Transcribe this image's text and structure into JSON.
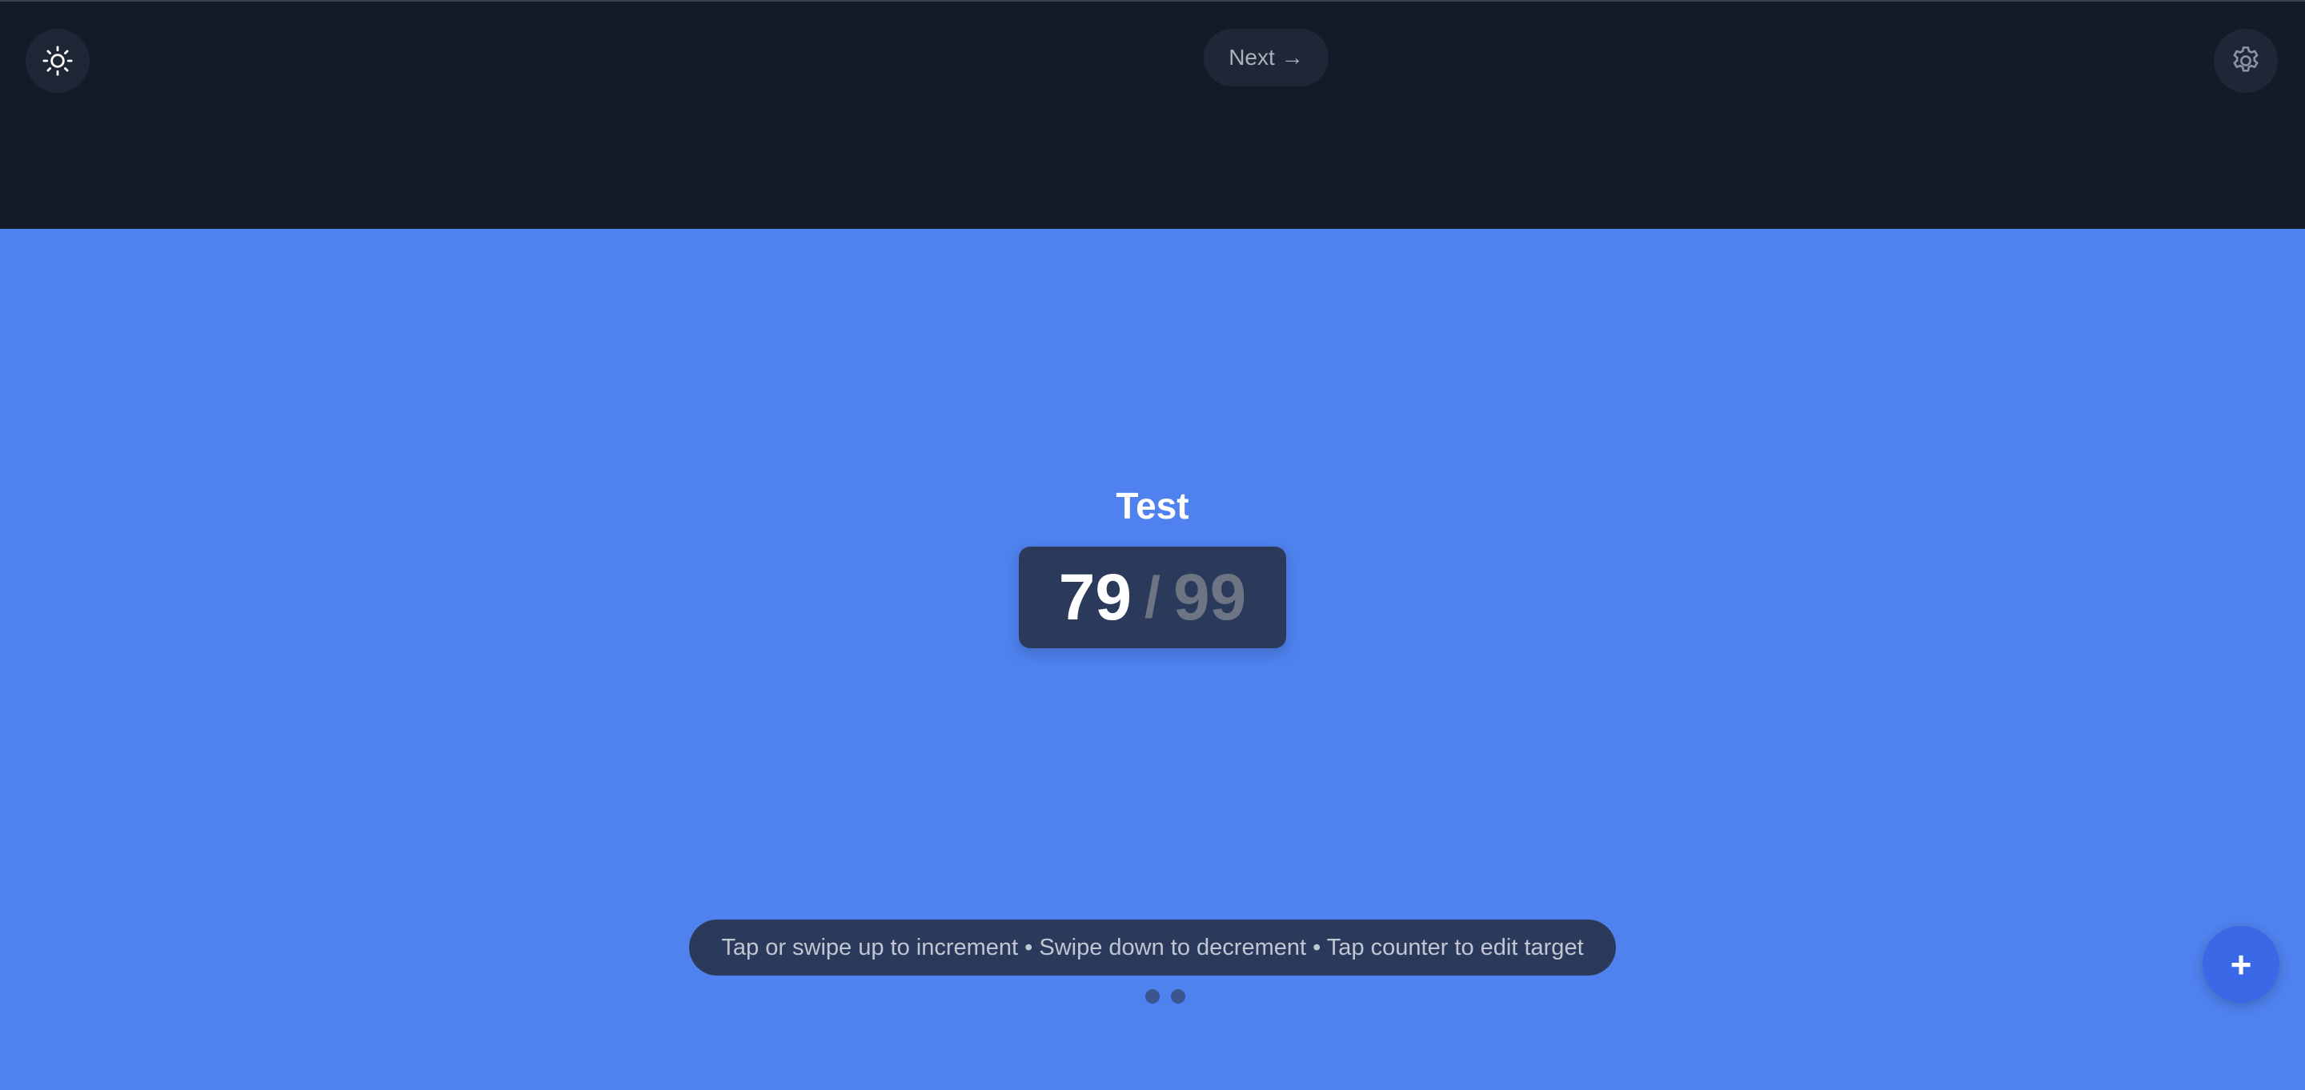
{
  "header": {
    "theme_icon": "sun-icon",
    "settings_icon": "gear-icon",
    "next_label": "Next",
    "next_icon": "→"
  },
  "counter": {
    "title": "Test",
    "current": "79",
    "separator": "/",
    "target": "99"
  },
  "hint": {
    "text": "Tap or swipe up to increment • Swipe down to decrement • Tap counter to edit target"
  },
  "pagination": {
    "pages": 2
  },
  "fab": {
    "label": "+"
  },
  "colors": {
    "background": "#4f82ee",
    "topbar": "#131a28",
    "panel": "#2b3a5a",
    "fab": "#3a68e6"
  }
}
